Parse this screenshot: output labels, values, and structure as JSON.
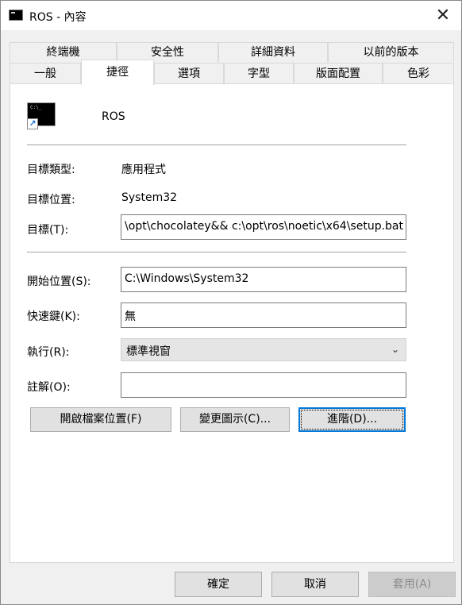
{
  "window": {
    "title": "ROS - 內容",
    "close_label": "✕"
  },
  "tabs_row1": [
    "終端機",
    "安全性",
    "詳細資料",
    "以前的版本"
  ],
  "tabs_row2": [
    "一般",
    "捷徑",
    "選項",
    "字型",
    "版面配置",
    "色彩"
  ],
  "active_tab": "捷徑",
  "shortcut": {
    "name": "ROS",
    "target_type_label": "目標類型:",
    "target_type_value": "應用程式",
    "target_location_label": "目標位置:",
    "target_location_value": "System32",
    "target_label": "目標(T):",
    "target_value": "\\opt\\chocolatey&& c:\\opt\\ros\\noetic\\x64\\setup.bat",
    "start_in_label": "開始位置(S):",
    "start_in_value": "C:\\Windows\\System32",
    "shortcut_key_label": "快速鍵(K):",
    "shortcut_key_value": "無",
    "run_label": "執行(R):",
    "run_value": "標準視窗",
    "comment_label": "註解(O):",
    "comment_value": "",
    "open_location_button": "開啟檔案位置(F)",
    "change_icon_button": "變更圖示(C)...",
    "advanced_button": "進階(D)..."
  },
  "footer": {
    "ok": "確定",
    "cancel": "取消",
    "apply": "套用(A)"
  }
}
